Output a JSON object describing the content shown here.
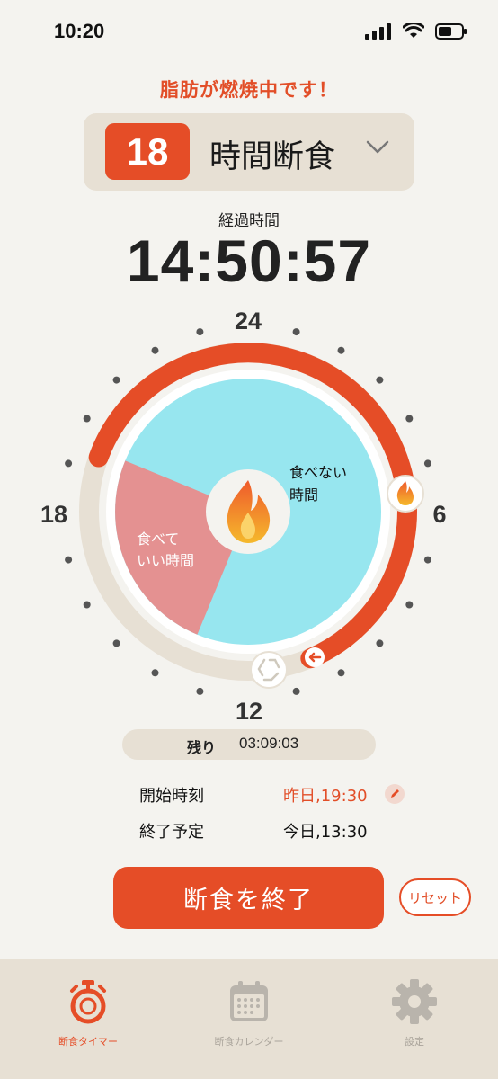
{
  "status_bar": {
    "time": "10:20"
  },
  "status_message": "脂肪が燃焼中です！",
  "plan": {
    "hours": "18",
    "label": "時間断食"
  },
  "elapsed": {
    "label": "経過時間",
    "value": "14:50:57"
  },
  "dial": {
    "hour_labels": {
      "top": "24",
      "right": "6",
      "bottom": "12",
      "left": "18"
    },
    "eating_window_label": [
      "食べて",
      "いい時間"
    ],
    "fasting_label": [
      "食べない",
      "時間"
    ],
    "colors": {
      "accent": "#e54d27",
      "fasting": "#97e6ef",
      "eating": "#e49191",
      "track": "#e7e0d4"
    }
  },
  "remaining": {
    "label": "残り",
    "value": "03:09:03"
  },
  "schedule": {
    "start_label": "開始時刻",
    "start_value": "昨日,19:30",
    "end_label": "終了予定",
    "end_value": "今日,13:30"
  },
  "actions": {
    "end_fast": "断食を終了",
    "reset": "リセット"
  },
  "tabs": [
    {
      "label": "断食タイマー",
      "icon": "stopwatch-icon",
      "active": true
    },
    {
      "label": "断食カレンダー",
      "icon": "calendar-icon",
      "active": false
    },
    {
      "label": "設定",
      "icon": "gear-icon",
      "active": false
    }
  ]
}
